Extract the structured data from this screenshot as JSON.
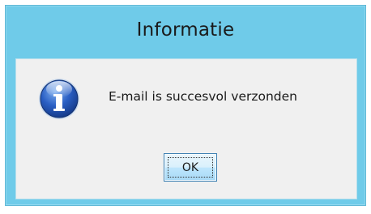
{
  "window": {
    "title": "Informatie"
  },
  "dialog": {
    "icon": "info-icon",
    "message": "E-mail is succesvol verzonden",
    "ok_label": "OK"
  },
  "colors": {
    "frame": "#6fcbe9",
    "client_background": "#f0f0f0",
    "icon_blue": "#2a5fc4"
  }
}
